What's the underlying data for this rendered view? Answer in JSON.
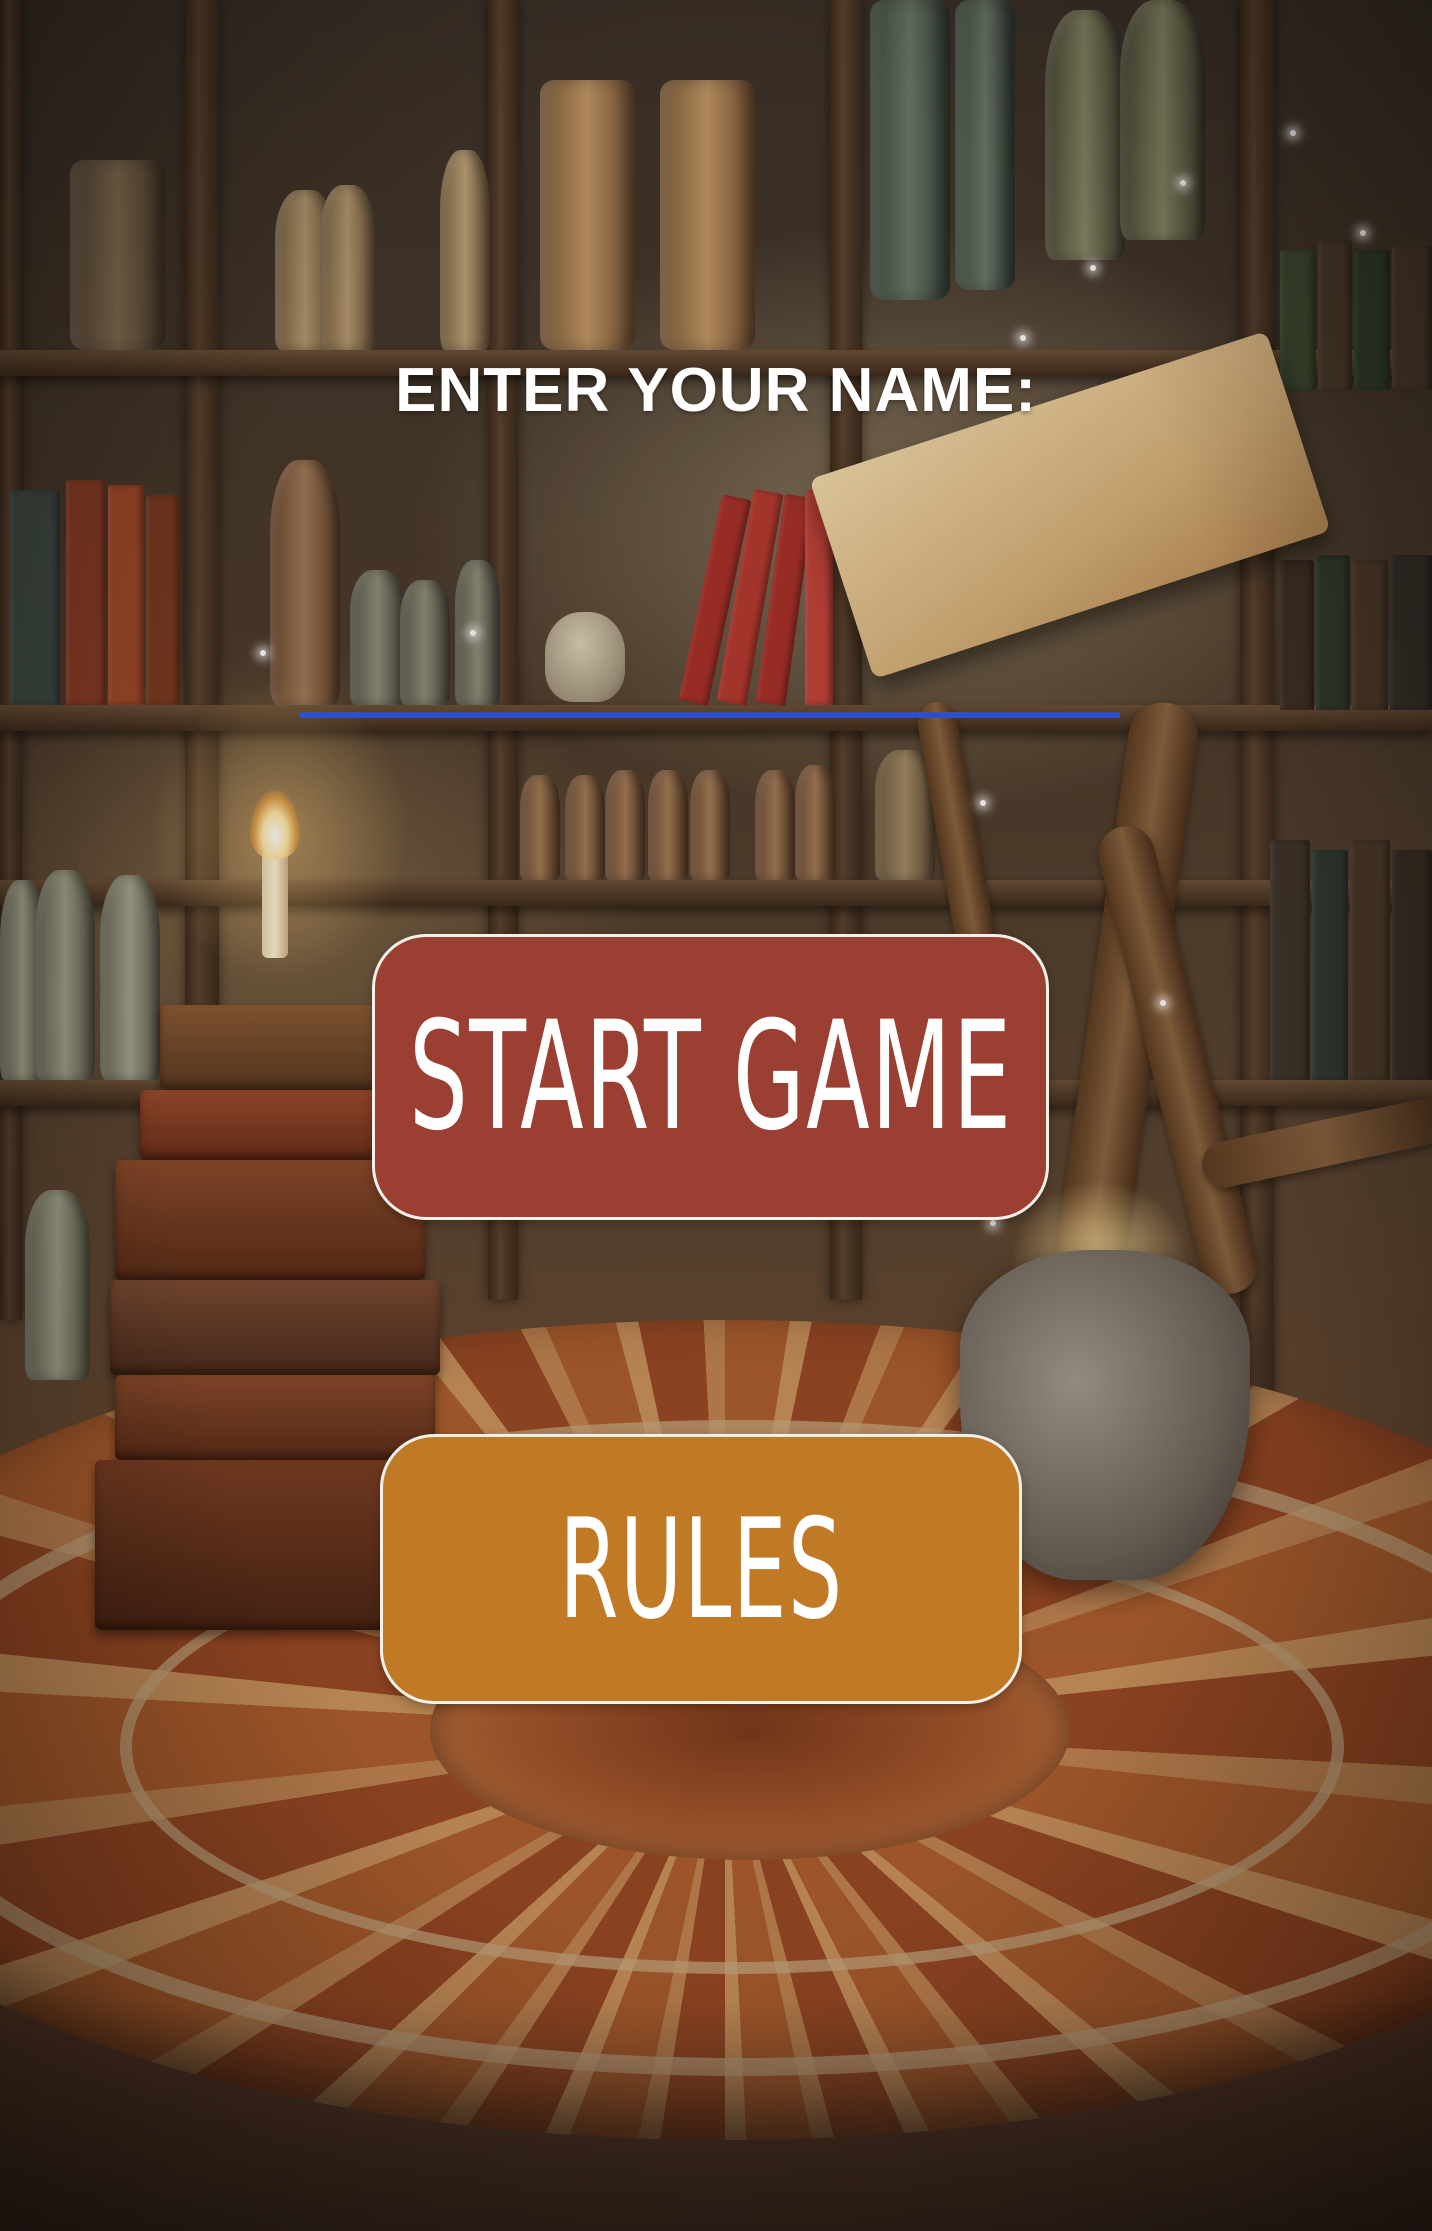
{
  "screen": {
    "name_prompt": "ENTER YOUR NAME:",
    "name_input": {
      "value": "",
      "placeholder": ""
    },
    "buttons": {
      "start_label": "START GAME",
      "rules_label": "RULES"
    }
  },
  "colors": {
    "start_button": "#9a3f32",
    "rules_button": "#c07a25",
    "input_underline": "#2f4fc8",
    "text": "#ffffff"
  },
  "icons": {
    "background": "magic-library-background"
  }
}
